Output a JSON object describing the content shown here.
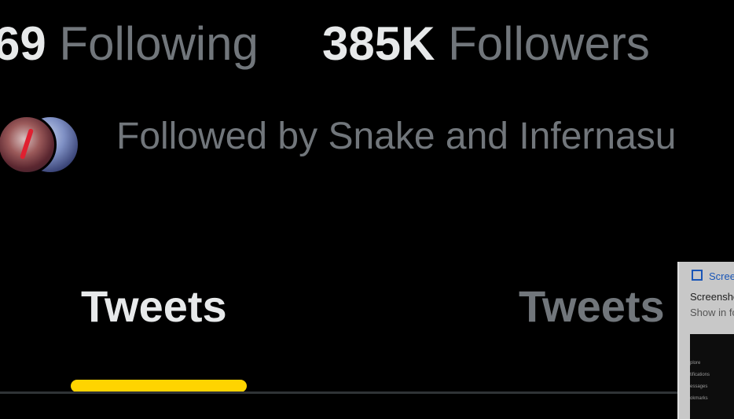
{
  "stats": {
    "following_count": "69",
    "following_label": "Following",
    "followers_count": "385K",
    "followers_label": "Followers"
  },
  "followed_by": "Followed by Snake and Infernasu",
  "tabs": [
    {
      "label": "Tweets",
      "active": true
    },
    {
      "label": "Tweets & ",
      "active": false
    }
  ],
  "notification": {
    "header": "Screer",
    "title": "Screensho",
    "subtitle": "Show in fo",
    "thumb_items": [
      "plore",
      "tifications",
      "essages",
      "okmarks"
    ]
  },
  "colors": {
    "background": "#000000",
    "primary_text": "#e7e9ea",
    "secondary_text": "#71767b",
    "accent": "#ffd400",
    "divider": "#2f3336"
  }
}
